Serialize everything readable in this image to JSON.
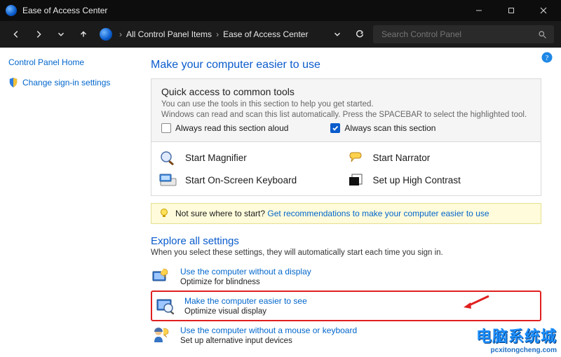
{
  "window": {
    "title": "Ease of Access Center"
  },
  "nav": {
    "breadcrumb": [
      "All Control Panel Items",
      "Ease of Access Center"
    ],
    "search_placeholder": "Search Control Panel"
  },
  "sidebar": {
    "home": "Control Panel Home",
    "items": [
      {
        "label": "Change sign-in settings"
      }
    ]
  },
  "main": {
    "heading": "Make your computer easier to use",
    "quick": {
      "title": "Quick access to common tools",
      "line1": "You can use the tools in this section to help you get started.",
      "line2": "Windows can read and scan this list automatically.  Press the SPACEBAR to select the highlighted tool.",
      "chk_read": "Always read this section aloud",
      "chk_scan": "Always scan this section"
    },
    "tools": {
      "magnifier": "Start Magnifier",
      "narrator": "Start Narrator",
      "osk": "Start On-Screen Keyboard",
      "contrast": "Set up High Contrast"
    },
    "info": {
      "prefix": "Not sure where to start? ",
      "link": "Get recommendations to make your computer easier to use"
    },
    "explore": {
      "title": "Explore all settings",
      "subtitle": "When you select these settings, they will automatically start each time you sign in.",
      "opts": [
        {
          "label": "Use the computer without a display",
          "desc": "Optimize for blindness"
        },
        {
          "label": "Make the computer easier to see",
          "desc": "Optimize visual display"
        },
        {
          "label": "Use the computer without a mouse or keyboard",
          "desc": "Set up alternative input devices"
        }
      ]
    }
  },
  "watermark": {
    "cn": "电脑系统城",
    "en": "pcxitongcheng.com"
  }
}
